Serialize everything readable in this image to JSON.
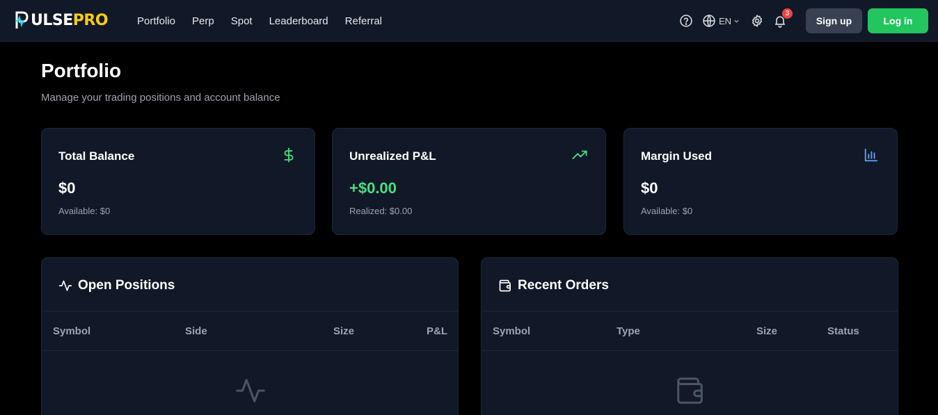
{
  "brand": {
    "name_left": "ULSE",
    "name_right": "PRO",
    "accent_color": "#facc15",
    "mark_icon": "pulse-p-icon"
  },
  "nav": {
    "links": [
      "Portfolio",
      "Perp",
      "Spot",
      "Leaderboard",
      "Referral"
    ],
    "help_icon": "help-circle-icon",
    "language": "EN",
    "language_icon": "globe-icon",
    "settings_icon": "gear-icon",
    "notifications_icon": "bell-icon",
    "notification_count": "3",
    "signup_label": "Sign up",
    "login_label": "Log in"
  },
  "page": {
    "title": "Portfolio",
    "subtitle": "Manage your trading positions and account balance"
  },
  "stats": [
    {
      "title": "Total Balance",
      "value": "$0",
      "sub": "Available: $0",
      "icon": "dollar-icon",
      "icon_color": "#4ade80"
    },
    {
      "title": "Unrealized P&L",
      "value": "+$0.00",
      "sub": "Realized: $0.00",
      "icon": "trending-up-icon",
      "icon_color": "#4ade80"
    },
    {
      "title": "Margin Used",
      "value": "$0",
      "sub": "Available: $0",
      "icon": "bar-chart-icon",
      "icon_color": "#60a5fa"
    }
  ],
  "positions": {
    "title": "Open Positions",
    "icon": "activity-icon",
    "columns": [
      "Symbol",
      "Side",
      "Size",
      "P&L"
    ]
  },
  "orders": {
    "title": "Recent Orders",
    "icon": "wallet-icon",
    "columns": [
      "Symbol",
      "Type",
      "Size",
      "Status"
    ]
  },
  "colors": {
    "background": "#000000",
    "surface": "#111827",
    "border": "#1f2937",
    "positive": "#4ade80",
    "login": "#22c55e",
    "badge": "#ef4444"
  }
}
